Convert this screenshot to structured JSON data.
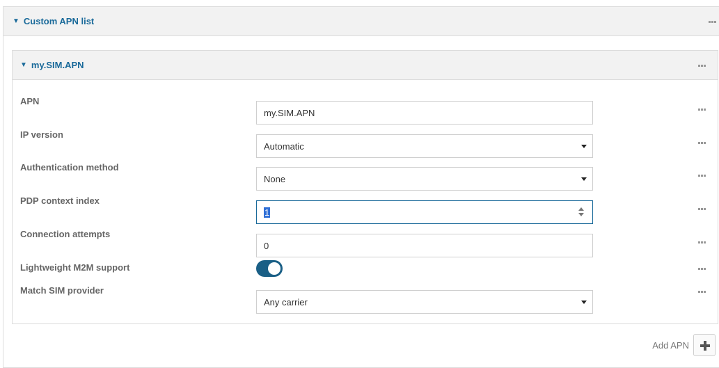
{
  "outer": {
    "title": "Custom APN list",
    "caret": "▼"
  },
  "inner": {
    "title": "my.SIM.APN",
    "caret": "▼"
  },
  "fields": {
    "apn": {
      "label": "APN",
      "value": "my.SIM.APN"
    },
    "ip_version": {
      "label": "IP version",
      "value": "Automatic"
    },
    "auth_method": {
      "label": "Authentication method",
      "value": "None"
    },
    "pdp_index": {
      "label": "PDP context index",
      "value": "1"
    },
    "conn_attempts": {
      "label": "Connection attempts",
      "value": "0"
    },
    "m2m": {
      "label": "Lightweight M2M support",
      "enabled": true
    },
    "sim_provider": {
      "label": "Match SIM provider",
      "value": "Any carrier"
    }
  },
  "add_apn": {
    "label": "Add APN"
  },
  "colors": {
    "accent": "#1a6a9a",
    "toggle_on": "#1a5f86",
    "selection": "#2f6fd6"
  },
  "icons": {
    "menu": "ellipsis-icon",
    "add": "plus-icon",
    "collapse": "caret-down-icon"
  }
}
